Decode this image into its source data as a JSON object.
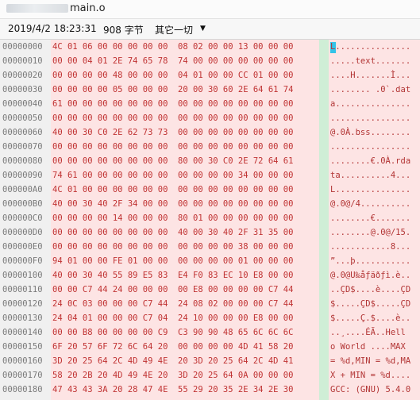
{
  "window": {
    "title": "main.o"
  },
  "status": {
    "datetime": "2019/4/2 18:23:31",
    "size": "908 字节",
    "encoding": "其它一切",
    "encoding_arrow": "▼"
  },
  "rows": [
    {
      "offset": "00000000",
      "hex": "4C 01 06 00 00 00 00 00  08 02 00 00 13 00 00 00",
      "ascii": "L..............."
    },
    {
      "offset": "00000010",
      "hex": "00 00 04 01 2E 74 65 78  74 00 00 00 00 00 00 00",
      "ascii": ".....text......."
    },
    {
      "offset": "00000020",
      "hex": "00 00 00 00 48 00 00 00  04 01 00 00 CC 01 00 00",
      "ascii": "....H.......Ì..."
    },
    {
      "offset": "00000030",
      "hex": "00 00 00 00 05 00 00 00  20 00 30 60 2E 64 61 74",
      "ascii": "........ .0`.dat"
    },
    {
      "offset": "00000040",
      "hex": "61 00 00 00 00 00 00 00  00 00 00 00 00 00 00 00",
      "ascii": "a..............."
    },
    {
      "offset": "00000050",
      "hex": "00 00 00 00 00 00 00 00  00 00 00 00 00 00 00 00",
      "ascii": "................"
    },
    {
      "offset": "00000060",
      "hex": "40 00 30 C0 2E 62 73 73  00 00 00 00 00 00 00 00",
      "ascii": "@.0À.bss........"
    },
    {
      "offset": "00000070",
      "hex": "00 00 00 00 00 00 00 00  00 00 00 00 00 00 00 00",
      "ascii": "................"
    },
    {
      "offset": "00000080",
      "hex": "00 00 00 00 00 00 00 00  80 00 30 C0 2E 72 64 61",
      "ascii": "........€.0À.rda"
    },
    {
      "offset": "00000090",
      "hex": "74 61 00 00 00 00 00 00  00 00 00 00 34 00 00 00",
      "ascii": "ta..........4..."
    },
    {
      "offset": "000000A0",
      "hex": "4C 01 00 00 00 00 00 00  00 00 00 00 00 00 00 00",
      "ascii": "L..............."
    },
    {
      "offset": "000000B0",
      "hex": "40 00 30 40 2F 34 00 00  00 00 00 00 00 00 00 00",
      "ascii": "@.0@/4.........."
    },
    {
      "offset": "000000C0",
      "hex": "00 00 00 00 14 00 00 00  80 01 00 00 00 00 00 00",
      "ascii": "........€......."
    },
    {
      "offset": "000000D0",
      "hex": "00 00 00 00 00 00 00 00  40 00 30 40 2F 31 35 00",
      "ascii": "........@.0@/15."
    },
    {
      "offset": "000000E0",
      "hex": "00 00 00 00 00 00 00 00  00 00 00 00 38 00 00 00",
      "ascii": "............8..."
    },
    {
      "offset": "000000F0",
      "hex": "94 01 00 00 FE 01 00 00  00 00 00 00 01 00 00 00",
      "ascii": "”...þ..........."
    },
    {
      "offset": "00000100",
      "hex": "40 00 30 40 55 89 E5 83  E4 F0 83 EC 10 E8 00 00",
      "ascii": "@.0@U‰åƒäðƒì.è.."
    },
    {
      "offset": "00000110",
      "hex": "00 00 C7 44 24 00 00 00  00 E8 00 00 00 00 C7 44",
      "ascii": "..ÇD$....è....ÇD"
    },
    {
      "offset": "00000120",
      "hex": "24 0C 03 00 00 00 C7 44  24 08 02 00 00 00 C7 44",
      "ascii": "$.....ÇD$.....ÇD"
    },
    {
      "offset": "00000130",
      "hex": "24 04 01 00 00 00 C7 04  24 10 00 00 00 E8 00 00",
      "ascii": "$.....Ç.$....è.."
    },
    {
      "offset": "00000140",
      "hex": "00 00 B8 00 00 00 00 C9  C3 90 90 48 65 6C 6C 6C",
      "ascii": "..¸....ÉÃ..Hell"
    },
    {
      "offset": "00000150",
      "hex": "6F 20 57 6F 72 6C 64 20  00 00 00 00 4D 41 58 20",
      "ascii": "o World ....MAX "
    },
    {
      "offset": "00000160",
      "hex": "3D 20 25 64 2C 4D 49 4E  20 3D 20 25 64 2C 4D 41",
      "ascii": "= %d,MIN = %d,MA"
    },
    {
      "offset": "00000170",
      "hex": "58 20 2B 20 4D 49 4E 20  3D 20 25 64 0A 00 00 00",
      "ascii": "X + MIN = %d...."
    },
    {
      "offset": "00000180",
      "hex": "47 43 43 3A 20 28 47 4E  55 29 20 35 2E 34 2E 30",
      "ascii": "GCC: (GNU) 5.4.0"
    }
  ]
}
